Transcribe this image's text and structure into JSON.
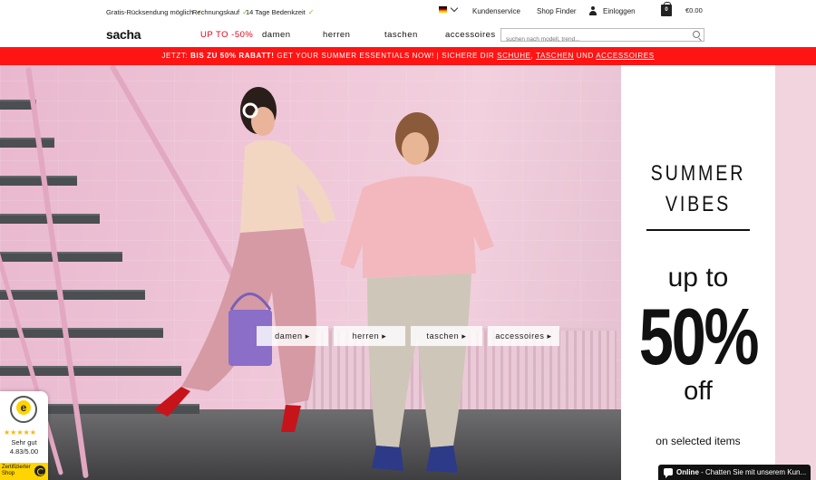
{
  "topbar": {
    "usps": [
      "Gratis-Rücksendung möglich",
      "Rechnungskauf",
      "14 Tage Bedenkzeit"
    ],
    "language_flag": "de-flag-icon",
    "service_link": "Kundenservice",
    "store_link": "Shop Finder",
    "login_link": "Einloggen",
    "cart_count": "0",
    "cart_total": "€0.00"
  },
  "nav": {
    "logo": "sacha",
    "sale": "UP TO -50%",
    "items": [
      "damen",
      "herren",
      "taschen",
      "accessoires"
    ],
    "search_placeholder": "suchen nach modell, trend..."
  },
  "promo": {
    "prefix": "JETZT: ",
    "highlight": "BIS ZU 50% RABATT!",
    "middle": " GET YOUR SUMMER ESSENTIALS NOW! | SICHERE DIR ",
    "link1": "SCHUHE",
    "sep": ", ",
    "link2": "TASCHEN",
    "und": " UND ",
    "link3": "ACCESSOIRES"
  },
  "hero": {
    "buttons": [
      "damen ▸",
      "herren ▸",
      "taschen ▸",
      "accessoires ▸"
    ]
  },
  "side_banner": {
    "line1": "SUMMER",
    "line2": "VIBES",
    "upto": "up to",
    "percent": "50%",
    "off": "off",
    "note": "on selected items"
  },
  "trust_badge": {
    "stars": "★★★★★",
    "rating_label": "Sehr gut",
    "score": "4.83/5.00",
    "cert": "Zertifizierter Shop"
  },
  "chat": {
    "status": "Online",
    "text": " - Chatten Sie mit unserem Kun..."
  },
  "colors": {
    "accent_red": "#ff1414",
    "sale_red": "#e4001b",
    "check_green": "#7bbf3a",
    "badge_yellow": "#ffd400"
  }
}
